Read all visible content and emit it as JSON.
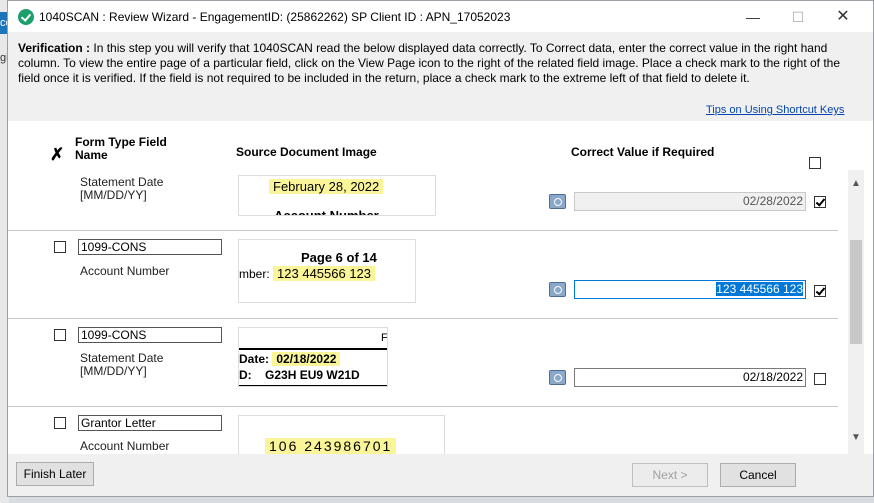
{
  "background": {
    "tab1": "co",
    "tab2": "gi"
  },
  "window": {
    "title": "1040SCAN : Review Wizard - EngagementID: (25862262)  SP Client ID : APN_17052023",
    "min": "—",
    "max": "☐",
    "close": "✕"
  },
  "instructions": {
    "heading": "Verification :",
    "text": "  In this step you will verify that 1040SCAN read the below displayed data correctly. To Correct data, enter the correct value in the right hand column. To view the entire page of a particular field, click on the View Page icon to the right of the related field image. Place a check mark to the right of the field once it is verified. If the field is not required to be included in the return, place a check mark to the extreme left of that field to delete it."
  },
  "tips_link": "Tips on Using Shortcut Keys",
  "headers": {
    "delete_glyph": "✗",
    "form_type": "Form Type Field Name",
    "source_image": "Source Document Image",
    "correct_value": "Correct Value if Required"
  },
  "rows": [
    {
      "form": "",
      "field": "Statement Date [MM/DD/YY]",
      "source": {
        "line1": "February 28, 2022",
        "line2": "Account Number"
      },
      "value": "02/28/2022",
      "verified": true,
      "disabled": true
    },
    {
      "form": "1099-CONS",
      "field": "Account Number",
      "source": {
        "line1": "Page 6 of 14",
        "line2_prefix": "mber:",
        "line2": "123 445566 123"
      },
      "value": "123 445566 123",
      "verified": true,
      "focused": true
    },
    {
      "form": "1099-CONS",
      "field": "Statement Date [MM/DD/YY]",
      "source": {
        "corner": "F",
        "line1_prefix": "Date:",
        "line1": "02/18/2022",
        "line2_prefix": "D:",
        "line2": "G23H EU9 W21D"
      },
      "value": "02/18/2022",
      "verified": false
    },
    {
      "form": "Grantor Letter",
      "field": "Account Number",
      "source": {
        "line1": "106 243986701"
      }
    }
  ],
  "buttons": {
    "finish_later": "Finish Later",
    "next": "Next >",
    "cancel": "Cancel"
  },
  "colors": {
    "highlight": "#fbf59a",
    "focus": "#0078d7",
    "link": "#0645ad"
  }
}
